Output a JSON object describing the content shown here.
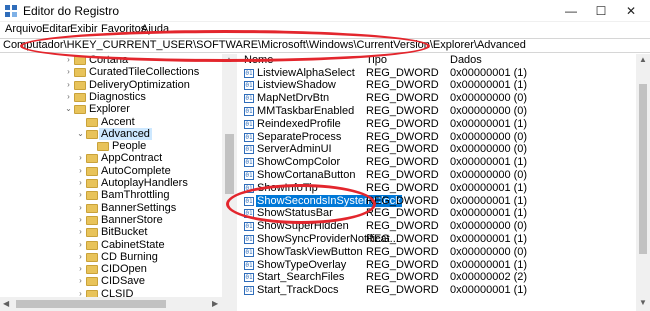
{
  "window": {
    "title": "Editor do Registro",
    "minimize_glyph": "—",
    "maximize_glyph": "☐",
    "close_glyph": "✕",
    "icon": "registry-editor-icon"
  },
  "menu": [
    "Arquivo",
    "Editar",
    "Exibir",
    "Favoritos",
    "Ajuda"
  ],
  "address": "Computador\\HKEY_CURRENT_USER\\SOFTWARE\\Microsoft\\Windows\\CurrentVersion\\Explorer\\Advanced",
  "tree": [
    {
      "label": "Cortana",
      "chevron": "›"
    },
    {
      "label": "CuratedTileCollections",
      "chevron": "›"
    },
    {
      "label": "DeliveryOptimization",
      "chevron": "›"
    },
    {
      "label": "Diagnostics",
      "chevron": "›"
    },
    {
      "label": "Explorer",
      "chevron": "⌄"
    },
    {
      "label": "Accent",
      "chevron": ""
    },
    {
      "label": "Advanced",
      "chevron": "⌄"
    },
    {
      "label": "People",
      "chevron": ""
    },
    {
      "label": "AppContract",
      "chevron": "›"
    },
    {
      "label": "AutoComplete",
      "chevron": "›"
    },
    {
      "label": "AutoplayHandlers",
      "chevron": "›"
    },
    {
      "label": "BamThrottling",
      "chevron": "›"
    },
    {
      "label": "BannerSettings",
      "chevron": "›"
    },
    {
      "label": "BannerStore",
      "chevron": "›"
    },
    {
      "label": "BitBucket",
      "chevron": "›"
    },
    {
      "label": "CabinetState",
      "chevron": "›"
    },
    {
      "label": "CD Burning",
      "chevron": "›"
    },
    {
      "label": "CIDOpen",
      "chevron": "›"
    },
    {
      "label": "CIDSave",
      "chevron": "›"
    },
    {
      "label": "CLSID",
      "chevron": "›"
    }
  ],
  "columns": {
    "name": "Nome",
    "type": "Tipo",
    "data": "Dados"
  },
  "values": [
    {
      "name": "ListviewAlphaSelect",
      "type": "REG_DWORD",
      "data": "0x00000001 (1)"
    },
    {
      "name": "ListviewShadow",
      "type": "REG_DWORD",
      "data": "0x00000001 (1)"
    },
    {
      "name": "MapNetDrvBtn",
      "type": "REG_DWORD",
      "data": "0x00000000 (0)"
    },
    {
      "name": "MMTaskbarEnabled",
      "type": "REG_DWORD",
      "data": "0x00000000 (0)"
    },
    {
      "name": "ReindexedProfile",
      "type": "REG_DWORD",
      "data": "0x00000001 (1)"
    },
    {
      "name": "SeparateProcess",
      "type": "REG_DWORD",
      "data": "0x00000000 (0)"
    },
    {
      "name": "ServerAdminUI",
      "type": "REG_DWORD",
      "data": "0x00000000 (0)"
    },
    {
      "name": "ShowCompColor",
      "type": "REG_DWORD",
      "data": "0x00000001 (1)"
    },
    {
      "name": "ShowCortanaButton",
      "type": "REG_DWORD",
      "data": "0x00000000 (0)"
    },
    {
      "name": "ShowInfoTip",
      "type": "REG_DWORD",
      "data": "0x00000001 (1)"
    },
    {
      "name": "ShowSecondsInSystemClock",
      "type": "REG_DWORD",
      "data": "0x00000001 (1)"
    },
    {
      "name": "ShowStatusBar",
      "type": "REG_DWORD",
      "data": "0x00000001 (1)"
    },
    {
      "name": "ShowSuperHidden",
      "type": "REG_DWORD",
      "data": "0x00000000 (0)"
    },
    {
      "name": "ShowSyncProviderNotificat...",
      "type": "REG_DWORD",
      "data": "0x00000001 (1)"
    },
    {
      "name": "ShowTaskViewButton",
      "type": "REG_DWORD",
      "data": "0x00000000 (0)"
    },
    {
      "name": "ShowTypeOverlay",
      "type": "REG_DWORD",
      "data": "0x00000001 (1)"
    },
    {
      "name": "Start_SearchFiles",
      "type": "REG_DWORD",
      "data": "0x00000002 (2)"
    },
    {
      "name": "Start_TrackDocs",
      "type": "REG_DWORD",
      "data": "0x00000001 (1)"
    }
  ],
  "selected_tree_item": "Advanced",
  "selected_value": "ShowSecondsInSystemClock",
  "colors": {
    "selection": "#0078d7",
    "highlight_ring": "#e3262d",
    "folder": "#e8c35a"
  }
}
